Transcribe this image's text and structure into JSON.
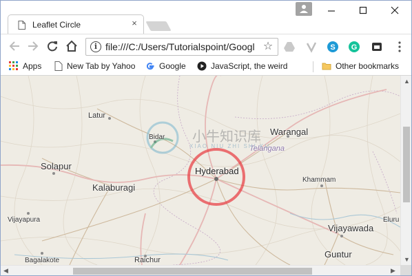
{
  "browser": {
    "tab_title": "Leaflet Circle",
    "tab_close_glyph": "×",
    "url": "file:///C:/Users/Tutorialspoint/Googl",
    "info_glyph": "i",
    "star_glyph": "☆"
  },
  "bookmarks": [
    {
      "label": "Apps",
      "icon": "apps-grid-icon"
    },
    {
      "label": "New Tab by Yahoo",
      "icon": "page-icon"
    },
    {
      "label": "Google",
      "icon": "google-g-icon"
    },
    {
      "label": "JavaScript, the weird",
      "icon": "video-play-icon"
    },
    {
      "label": "Other bookmarks",
      "icon": "folder-icon"
    }
  ],
  "map": {
    "places": [
      "Latur",
      "Bidar",
      "Warangal",
      "Telangana",
      "Solapur",
      "Hyderabad",
      "Kalaburagi",
      "Khammam",
      "Vijayapura",
      "Vijayawada",
      "Eluru",
      "Guntur",
      "Bagalakote",
      "Raichur"
    ],
    "circle_color": "#e8393f",
    "watermark_cn": "小牛知识库",
    "watermark_en": "XIAO NIU ZHI SHI KU"
  },
  "colors": {
    "map_background": "#efece4",
    "road_major": "#e8c2c0",
    "road_secondary": "#c9b8a0",
    "state_label": "#8c76a8"
  }
}
